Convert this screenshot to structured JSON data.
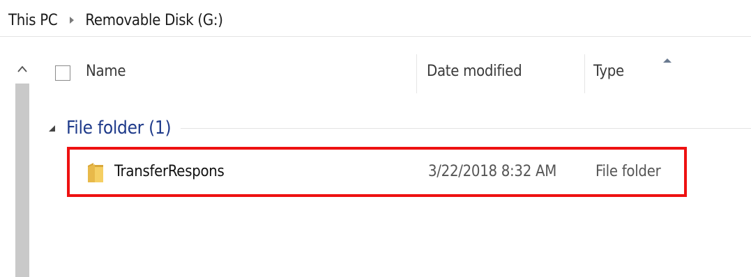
{
  "breadcrumb": {
    "items": [
      "This PC",
      "Removable Disk (G:)"
    ]
  },
  "columns": {
    "name": "Name",
    "date_modified": "Date modified",
    "type": "Type"
  },
  "group": {
    "title": "File folder (1)"
  },
  "files": [
    {
      "name": "TransferRespons",
      "date_modified": "3/22/2018 8:32 AM",
      "type": "File folder",
      "icon": "folder-icon"
    }
  ],
  "colors": {
    "highlight_border": "#ee1111",
    "group_title": "#1e3a8a",
    "scroll_track": "#c9c9c9"
  }
}
